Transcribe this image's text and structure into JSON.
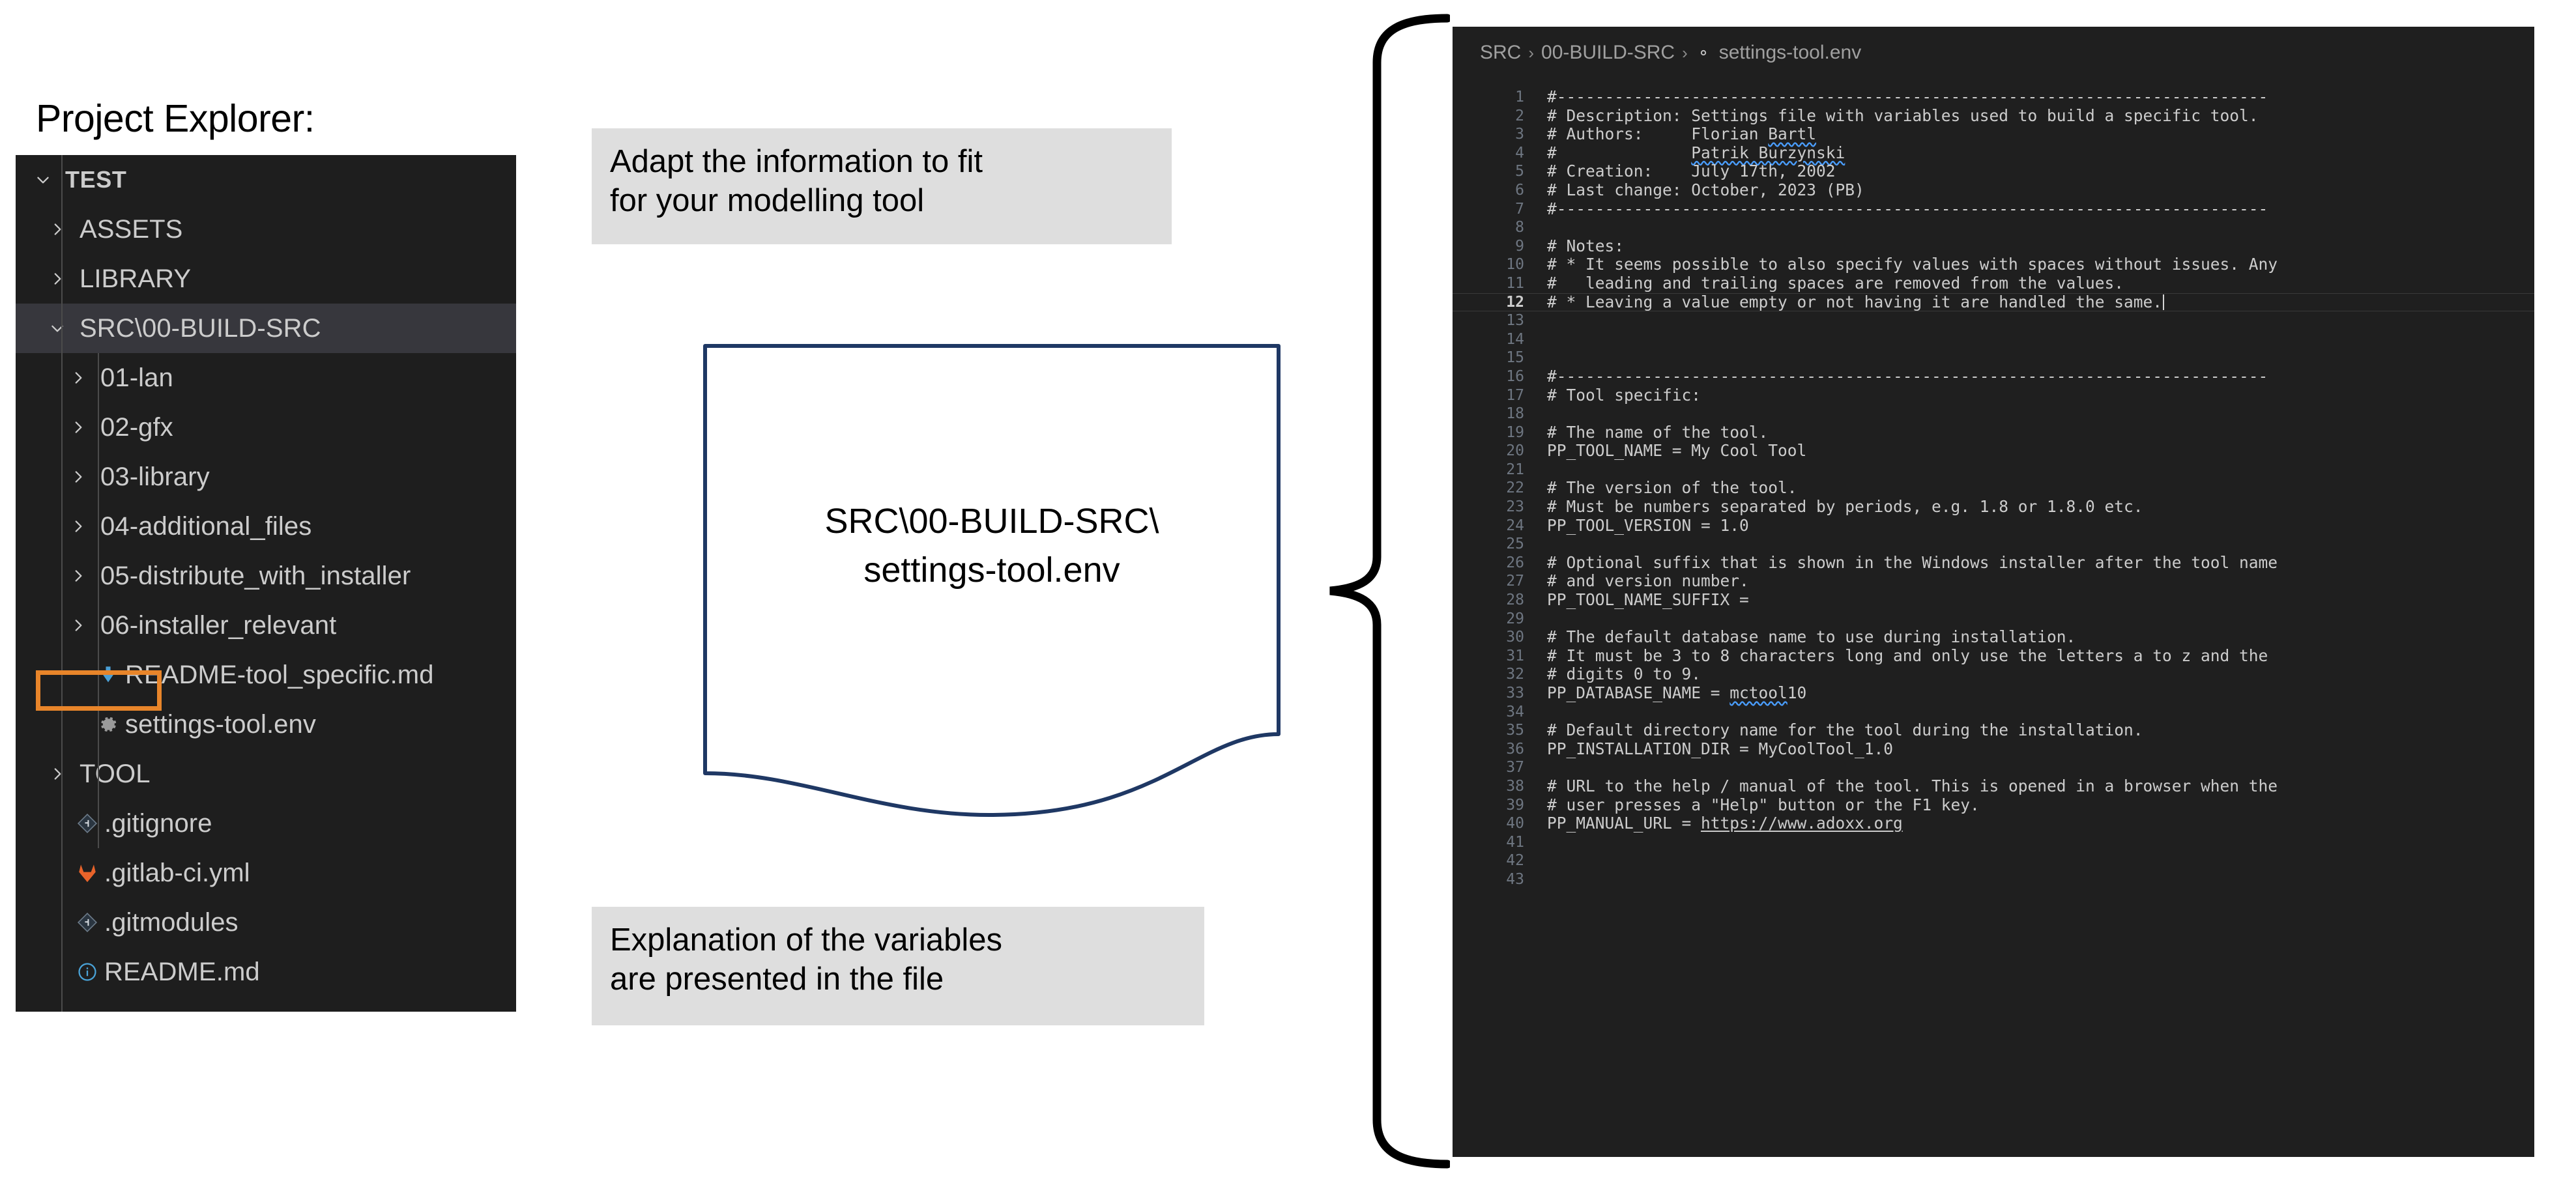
{
  "explorer": {
    "title": "Project Explorer:",
    "rows": [
      {
        "label": "TEST",
        "chev": "chevron-down",
        "indent": 0,
        "bold": true,
        "icon": "none",
        "selected": false,
        "underline": false,
        "name": "tree-item-test"
      },
      {
        "label": "ASSETS",
        "chev": "chevron-right",
        "indent": 1,
        "bold": false,
        "icon": "none",
        "selected": false,
        "underline": false,
        "name": "tree-item-assets"
      },
      {
        "label": "LIBRARY",
        "chev": "chevron-right",
        "indent": 1,
        "bold": false,
        "icon": "none",
        "selected": false,
        "underline": false,
        "name": "tree-item-library"
      },
      {
        "label": "SRC\\ 00-BUILD-SRC",
        "chev": "chevron-down",
        "indent": 1,
        "bold": false,
        "icon": "none",
        "selected": true,
        "underline": true,
        "name": "tree-item-src-00-build-src"
      },
      {
        "label": "01-lan",
        "chev": "chevron-right",
        "indent": 2,
        "bold": false,
        "icon": "none",
        "selected": false,
        "underline": false,
        "name": "tree-item-01-lan"
      },
      {
        "label": "02-gfx",
        "chev": "chevron-right",
        "indent": 2,
        "bold": false,
        "icon": "none",
        "selected": false,
        "underline": false,
        "name": "tree-item-02-gfx"
      },
      {
        "label": "03-library",
        "chev": "chevron-right",
        "indent": 2,
        "bold": false,
        "icon": "none",
        "selected": false,
        "underline": false,
        "name": "tree-item-03-library"
      },
      {
        "label": "04-additional_files",
        "chev": "chevron-right",
        "indent": 2,
        "bold": false,
        "icon": "none",
        "selected": false,
        "underline": false,
        "name": "tree-item-04-additional-files"
      },
      {
        "label": "05-distribute_with_installer",
        "chev": "chevron-right",
        "indent": 2,
        "bold": false,
        "icon": "none",
        "selected": false,
        "underline": false,
        "name": "tree-item-05-distribute-with-installer"
      },
      {
        "label": "06-installer_relevant",
        "chev": "chevron-right",
        "indent": 2,
        "bold": false,
        "icon": "none",
        "selected": false,
        "underline": false,
        "name": "tree-item-06-installer-relevant"
      },
      {
        "label": "README-tool_specific.md",
        "chev": "none",
        "indent": 2,
        "bold": false,
        "icon": "markdown-icon",
        "selected": false,
        "underline": false,
        "name": "tree-item-readme-tool-specific"
      },
      {
        "label": "settings-tool.env",
        "chev": "none",
        "indent": 2,
        "bold": false,
        "icon": "gear-icon",
        "selected": false,
        "underline": false,
        "name": "tree-item-settings-tool-env"
      },
      {
        "label": "TOOL",
        "chev": "chevron-right",
        "indent": 1,
        "bold": false,
        "icon": "none",
        "selected": false,
        "underline": false,
        "name": "tree-item-tool"
      },
      {
        "label": ".gitignore",
        "chev": "none",
        "indent": 1,
        "bold": false,
        "icon": "git-icon",
        "selected": false,
        "underline": false,
        "name": "tree-item-gitignore"
      },
      {
        "label": ".gitlab-ci.yml",
        "chev": "none",
        "indent": 1,
        "bold": false,
        "icon": "gitlab-icon",
        "selected": false,
        "underline": false,
        "name": "tree-item-gitlab-ci-yml"
      },
      {
        "label": ".gitmodules",
        "chev": "none",
        "indent": 1,
        "bold": false,
        "icon": "git-icon",
        "selected": false,
        "underline": false,
        "name": "tree-item-gitmodules"
      },
      {
        "label": "README.md",
        "chev": "none",
        "indent": 1,
        "bold": false,
        "icon": "info-icon",
        "selected": false,
        "underline": false,
        "name": "tree-item-readme-md"
      }
    ],
    "highlight_color": "#e8852a"
  },
  "callouts": {
    "adapt": "Adapt the information to fit\nfor your modelling tool",
    "explain": "Explanation of the variables\nare presented in the file",
    "document_path": "SRC\\00-BUILD-SRC\\\nsettings-tool.env"
  },
  "editor": {
    "breadcrumb": {
      "part1": "SRC",
      "part2": "00-BUILD-SRC",
      "file": "settings-tool.env",
      "separator": "›",
      "file_icon": "gear-icon"
    },
    "current_line": 12,
    "lines": [
      {
        "n": 1,
        "text": "#--------------------------------------------------------------------------",
        "cm": true
      },
      {
        "n": 2,
        "text": "# Description: Settings file with variables used to build a specific tool.",
        "cm": true
      },
      {
        "n": 3,
        "text": "# Authors:     Florian Bartl",
        "cm": true,
        "squig": "Bartl"
      },
      {
        "n": 4,
        "text": "#              Patrik Burzynski",
        "cm": true,
        "squig": "Patrik Burzynski"
      },
      {
        "n": 5,
        "text": "# Creation:    July 17th, 2002",
        "cm": true
      },
      {
        "n": 6,
        "text": "# Last change: October, 2023 (PB)",
        "cm": true
      },
      {
        "n": 7,
        "text": "#--------------------------------------------------------------------------",
        "cm": true
      },
      {
        "n": 8,
        "text": "",
        "cm": true
      },
      {
        "n": 9,
        "text": "# Notes:",
        "cm": true
      },
      {
        "n": 10,
        "text": "# * It seems possible to also specify values with spaces without issues. Any",
        "cm": true
      },
      {
        "n": 11,
        "text": "#   leading and trailing spaces are removed from the values.",
        "cm": true
      },
      {
        "n": 12,
        "text": "# * Leaving a value empty or not having it are handled the same.",
        "cm": true
      },
      {
        "n": 13,
        "text": "",
        "cm": true
      },
      {
        "n": 14,
        "text": "",
        "cm": true
      },
      {
        "n": 15,
        "text": "",
        "cm": true
      },
      {
        "n": 16,
        "text": "#--------------------------------------------------------------------------",
        "cm": true
      },
      {
        "n": 17,
        "text": "# Tool specific:",
        "cm": true
      },
      {
        "n": 18,
        "text": "",
        "cm": true
      },
      {
        "n": 19,
        "text": "# The name of the tool.",
        "cm": true
      },
      {
        "n": 20,
        "text": "PP_TOOL_NAME = My Cool Tool",
        "cm": false
      },
      {
        "n": 21,
        "text": "",
        "cm": true
      },
      {
        "n": 22,
        "text": "# The version of the tool.",
        "cm": true
      },
      {
        "n": 23,
        "text": "# Must be numbers separated by periods, e.g. 1.8 or 1.8.0 etc.",
        "cm": true
      },
      {
        "n": 24,
        "text": "PP_TOOL_VERSION = 1.0",
        "cm": false
      },
      {
        "n": 25,
        "text": "",
        "cm": true
      },
      {
        "n": 26,
        "text": "# Optional suffix that is shown in the Windows installer after the tool name",
        "cm": true
      },
      {
        "n": 27,
        "text": "# and version number.",
        "cm": true
      },
      {
        "n": 28,
        "text": "PP_TOOL_NAME_SUFFIX =",
        "cm": false
      },
      {
        "n": 29,
        "text": "",
        "cm": true
      },
      {
        "n": 30,
        "text": "# The default database name to use during installation.",
        "cm": true
      },
      {
        "n": 31,
        "text": "# It must be 3 to 8 characters long and only use the letters a to z and the",
        "cm": true
      },
      {
        "n": 32,
        "text": "# digits 0 to 9.",
        "cm": true
      },
      {
        "n": 33,
        "text": "PP_DATABASE_NAME = mctool10",
        "cm": false,
        "squig": "mctool"
      },
      {
        "n": 34,
        "text": "",
        "cm": true
      },
      {
        "n": 35,
        "text": "# Default directory name for the tool during the installation.",
        "cm": true
      },
      {
        "n": 36,
        "text": "PP_INSTALLATION_DIR = MyCoolTool_1.0",
        "cm": false
      },
      {
        "n": 37,
        "text": "",
        "cm": true
      },
      {
        "n": 38,
        "text": "# URL to the help / manual of the tool. This is opened in a browser when the",
        "cm": true
      },
      {
        "n": 39,
        "text": "# user presses a \"Help\" button or the F1 key.",
        "cm": true
      },
      {
        "n": 40,
        "text": "PP_MANUAL_URL = https://www.adoxx.org",
        "cm": false,
        "link": "https://www.adoxx.org"
      },
      {
        "n": 41,
        "text": "",
        "cm": true
      },
      {
        "n": 42,
        "text": "",
        "cm": true
      },
      {
        "n": 43,
        "text": "",
        "cm": true
      }
    ]
  }
}
